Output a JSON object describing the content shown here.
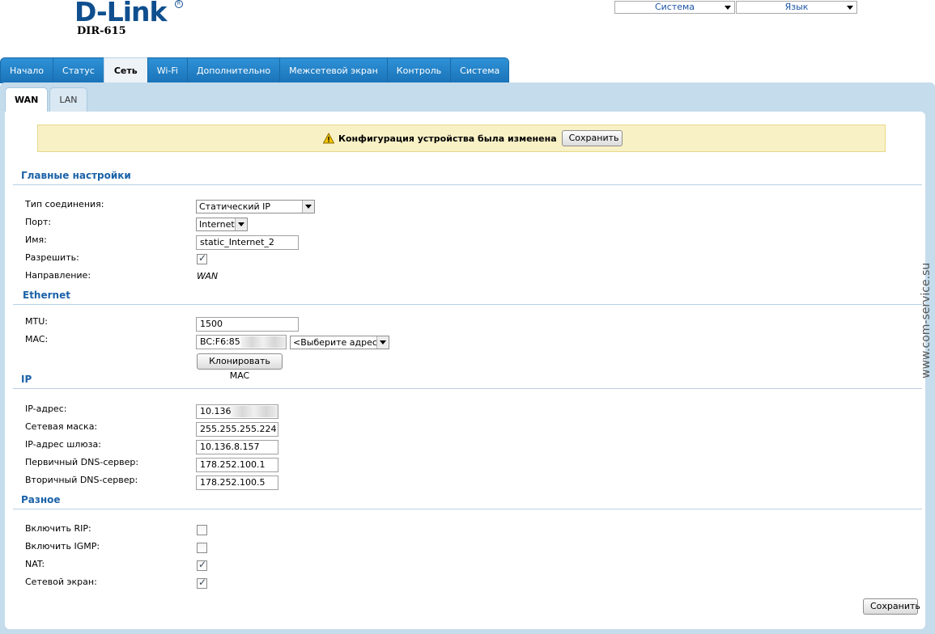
{
  "header": {
    "brand": "D-Link",
    "model": "DIR-615",
    "system_select": "Система",
    "language_select": "Язык"
  },
  "main_tabs": [
    "Начало",
    "Статус",
    "Сеть",
    "Wi-Fi",
    "Дополнительно",
    "Межсетевой экран",
    "Контроль",
    "Система"
  ],
  "sub_tabs": [
    "WAN",
    "LAN"
  ],
  "notice": {
    "text": "Конфигурация устройства была изменена",
    "save_label": "Сохранить"
  },
  "main_settings": {
    "title": "Главные настройки",
    "connection_type_label": "Тип соединения:",
    "connection_type_value": "Статический IP",
    "port_label": "Порт:",
    "port_value": "Internet",
    "name_label": "Имя:",
    "name_value": "static_Internet_2",
    "enable_label": "Разрешить:",
    "direction_label": "Направление:",
    "direction_value": "WAN"
  },
  "ethernet": {
    "title": "Ethernet",
    "mtu_label": "MTU:",
    "mtu_value": "1500",
    "mac_label": "MAC:",
    "mac_value": "BC:F6:85:",
    "mac_select": "<Выберите адрес>",
    "clone_mac_label": "Клонировать MAC"
  },
  "ip": {
    "title": "IP",
    "ip_label": "IP-адрес:",
    "ip_value": "10.136.",
    "mask_label": "Сетевая маска:",
    "mask_value": "255.255.255.224",
    "gateway_label": "IP-адрес шлюза:",
    "gateway_value": "10.136.8.157",
    "dns1_label": "Первичный DNS-сервер:",
    "dns1_value": "178.252.100.1",
    "dns2_label": "Вторичный DNS-сервер:",
    "dns2_value": "178.252.100.5"
  },
  "misc": {
    "title": "Разное",
    "rip_label": "Включить RIP:",
    "igmp_label": "Включить IGMP:",
    "nat_label": "NAT:",
    "firewall_label": "Сетевой экран:"
  },
  "checkboxes": {
    "enable": true,
    "rip": false,
    "igmp": false,
    "nat": true,
    "firewall": true
  },
  "footer": {
    "save_label": "Сохранить"
  },
  "watermark": "www.com-service.su",
  "colors": {
    "tab_blue": "#2f92d7",
    "section_title": "#1b62a8",
    "frame": "#c5dcec",
    "notice_bg": "#f8f1c6"
  }
}
